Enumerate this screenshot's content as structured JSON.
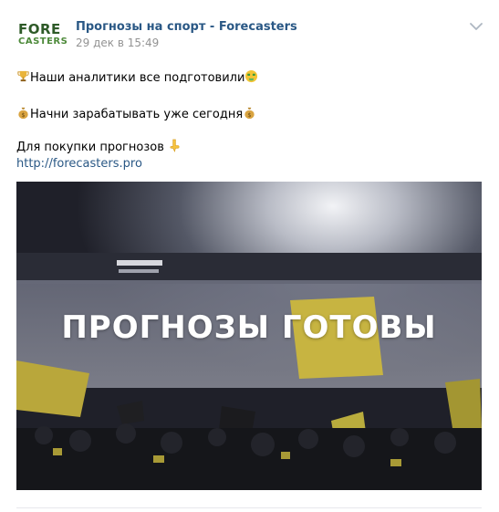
{
  "post": {
    "author": "Прогнозы на спорт - Forecasters",
    "date": "29 дек в 15:49",
    "logo": {
      "line1": "FORE",
      "line2": "CASTERS"
    },
    "lines": {
      "line1": "Наши аналитики все подготовили",
      "line2": "Начни зарабатывать уже сегодня",
      "line3": "Для покупки прогнозов",
      "link": "http://forecasters.pro"
    },
    "image_caption": "ПРОГНОЗЫ ГОТОВЫ",
    "icons": [
      "avatar-logo",
      "chevron-down-icon",
      "trophy-icon",
      "money-face-icon",
      "money-bag-icon",
      "point-down-icon"
    ],
    "colors": {
      "link": "#2a5885",
      "meta": "#939393"
    }
  }
}
